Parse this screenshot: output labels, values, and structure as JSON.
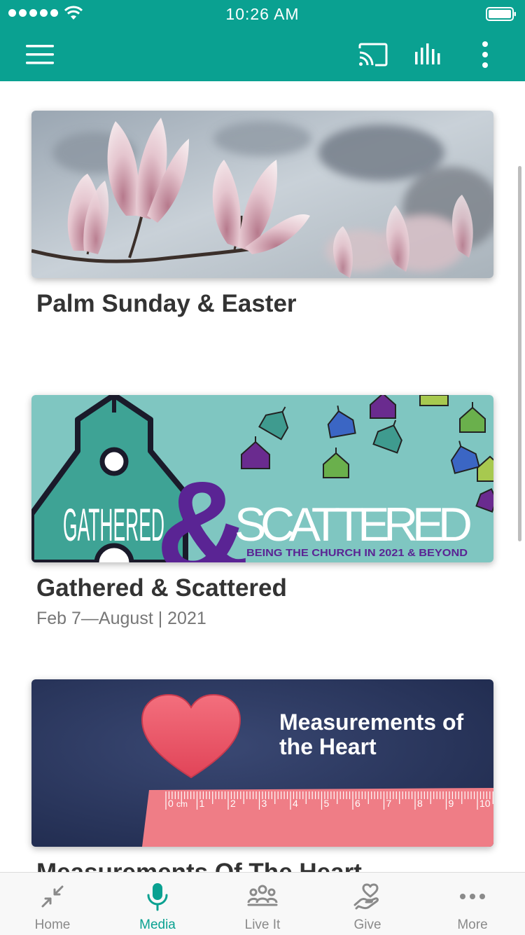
{
  "status_bar": {
    "time": "10:26 AM"
  },
  "nav_bar": {
    "icons": [
      "menu-icon",
      "cast-icon",
      "audio-bars-icon",
      "more-vertical-icon"
    ]
  },
  "series": [
    {
      "title": "Palm Sunday & Easter",
      "subtitle": "",
      "image": "magnolia-blossoms"
    },
    {
      "title": "Gathered & Scattered",
      "subtitle": "Feb 7—August | 2021",
      "image": "church-banner",
      "banner": {
        "word1": "GATHERED",
        "ampersand": "&",
        "word2": "SCATTERED",
        "tagline": "BEING THE CHURCH IN 2021 & BEYOND"
      }
    },
    {
      "title": "Measurements Of The Heart",
      "subtitle": "",
      "image": "heart-and-ruler",
      "banner": {
        "line1": "Measurements of",
        "line2": "the Heart",
        "ruler_unit": "cm",
        "ruler_numbers": [
          "0",
          "1",
          "2",
          "3",
          "4",
          "5",
          "6",
          "7",
          "8",
          "9",
          "10"
        ]
      }
    }
  ],
  "tab_bar": {
    "tabs": [
      {
        "label": "Home",
        "icon": "collapse-arrows-icon",
        "active": false
      },
      {
        "label": "Media",
        "icon": "microphone-icon",
        "active": true
      },
      {
        "label": "Live It",
        "icon": "people-group-icon",
        "active": false
      },
      {
        "label": "Give",
        "icon": "heart-hand-icon",
        "active": false
      },
      {
        "label": "More",
        "icon": "more-horizontal-icon",
        "active": false
      }
    ]
  },
  "colors": {
    "brand": "#0aa191",
    "tab_inactive": "#8a8a8a",
    "title": "#333333",
    "subtitle": "#777777"
  }
}
